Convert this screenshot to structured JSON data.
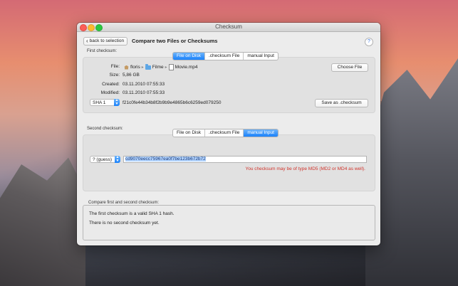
{
  "window": {
    "title": "Checksum"
  },
  "header": {
    "back_label": "back to selection",
    "title": "Compare two Files or Checksums",
    "help_label": "?"
  },
  "first": {
    "section_label": "First checksum:",
    "tabs": [
      "File on Disk",
      ".checksum File",
      "manual Input"
    ],
    "active_tab": 0,
    "file_label": "File:",
    "path": [
      "floris",
      "Filme",
      "Movie.mp4"
    ],
    "size_label": "Size:",
    "size": "5,86 GB",
    "created_label": "Created:",
    "created": "03.11.2010 07:55:33",
    "modified_label": "Modified:",
    "modified": "03.11.2010 07:55:33",
    "choose_button": "Choose File",
    "algorithm": "SHA 1",
    "checksum": "f21c0fe44b34b8f2b9b9e4865b6c6259ed079250",
    "save_button": "Save as .checksum"
  },
  "second": {
    "section_label": "Second checksum:",
    "tabs": [
      "File on Disk",
      ".checksum File",
      "manual Input"
    ],
    "active_tab": 2,
    "algorithm": "? (guess)",
    "input_value": "cd9070eecc75967ea0f7be123b672b72",
    "message": "You checksum may be of type MD5 (MD2 or MD4 as well)."
  },
  "compare": {
    "legend": "Compare first and second checksum:",
    "line1": "The first checksum is a valid SHA 1 hash.",
    "line2": "There is no second checksum yet."
  },
  "colors": {
    "accent": "#1a82fb",
    "error": "#d0342c"
  },
  "icons": [
    "home-icon",
    "folder-icon",
    "file-icon",
    "chevron-left-icon",
    "popup-arrows-icon"
  ]
}
